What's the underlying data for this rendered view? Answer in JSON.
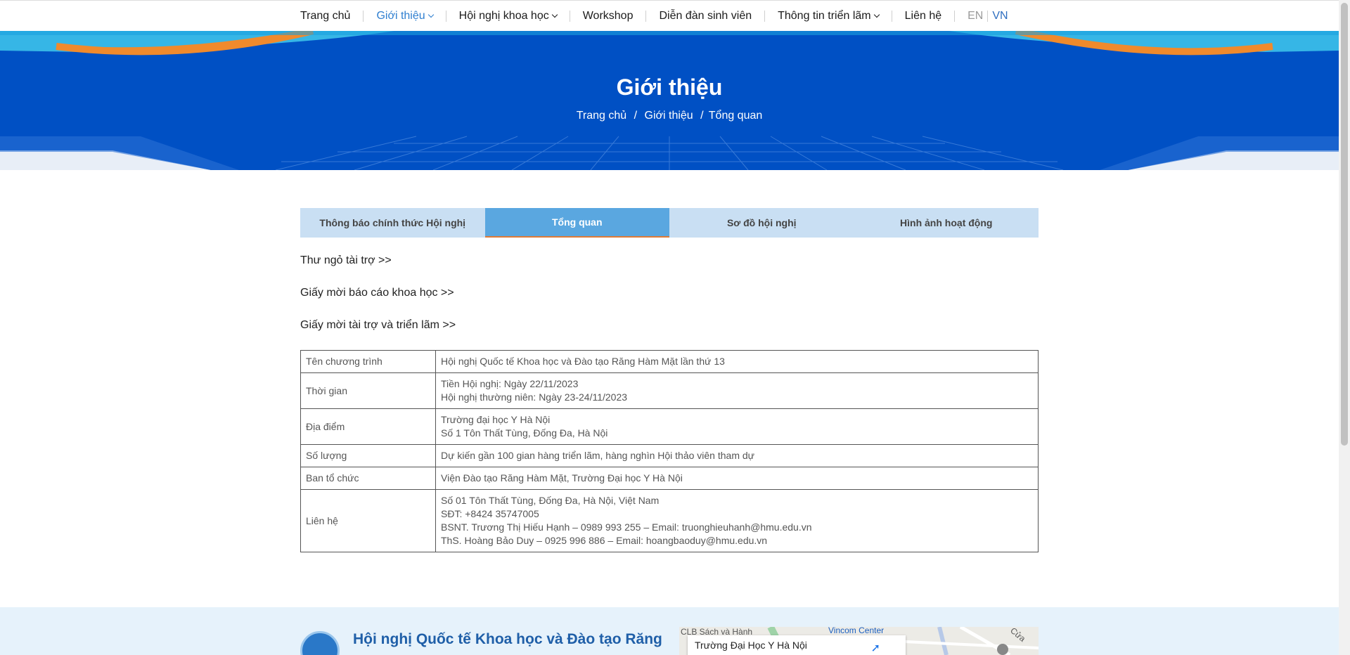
{
  "nav": {
    "items": [
      {
        "label": "Trang chủ",
        "dropdown": false
      },
      {
        "label": "Giới thiệu",
        "dropdown": true,
        "active": true
      },
      {
        "label": "Hội nghị khoa học",
        "dropdown": true
      },
      {
        "label": "Workshop",
        "dropdown": false
      },
      {
        "label": "Diễn đàn sinh viên",
        "dropdown": false
      },
      {
        "label": "Thông tin triển lãm",
        "dropdown": true
      },
      {
        "label": "Liên hệ",
        "dropdown": false
      }
    ],
    "lang_en": "EN",
    "lang_vn": "VN"
  },
  "banner": {
    "title": "Giới thiệu",
    "breadcrumb": [
      "Trang chủ",
      "Giới thiệu",
      "Tổng quan"
    ]
  },
  "tabs": [
    {
      "label": "Thông báo chính thức Hội nghị",
      "active": false
    },
    {
      "label": "Tổng quan",
      "active": true
    },
    {
      "label": "Sơ đồ hội nghị",
      "active": false
    },
    {
      "label": "Hình ảnh hoạt động",
      "active": false
    }
  ],
  "links": [
    "Thư ngỏ tài trợ >>",
    "Giấy mời báo cáo khoa học >>",
    "Giấy mời tài trợ và triển lãm >>"
  ],
  "table": [
    {
      "label": "Tên chương trình",
      "lines": [
        "Hội nghị Quốc tế Khoa học và Đào tạo Răng Hàm Mặt lần thứ 13"
      ]
    },
    {
      "label": "Thời gian",
      "lines": [
        "Tiền Hội nghị: Ngày 22/11/2023",
        "Hội nghị thường niên: Ngày 23-24/11/2023"
      ]
    },
    {
      "label": "Địa điểm",
      "lines": [
        "Trường đại học Y Hà Nội",
        "Số 1 Tôn Thất Tùng, Đống Đa, Hà Nội"
      ]
    },
    {
      "label": "Số lượng",
      "lines": [
        "Dự kiến gần 100 gian hàng triển lãm, hàng nghìn Hội thảo viên tham dự"
      ]
    },
    {
      "label": "Ban tổ chức",
      "lines": [
        "Viện Đào tạo Răng Hàm Mặt, Trường Đại học Y Hà Nội"
      ]
    },
    {
      "label": "Liên hệ",
      "lines": [
        "Số 01 Tôn Thất Tùng, Đống Đa, Hà Nội, Việt Nam",
        "SĐT: +8424 35747005",
        "BSNT. Trương Thị Hiếu Hạnh – 0989 993 255 – Email: truonghieuhanh@hmu.edu.vn",
        "ThS. Hoàng Bảo Duy – 0925 996 886 – Email: hoangbaoduy@hmu.edu.vn"
      ]
    }
  ],
  "footer": {
    "title": "Hội nghị Quốc tế Khoa học và Đào tạo Răng",
    "map_card_title": "Trường Đại Học Y Hà Nội",
    "map_labels": [
      "CLB Sách và Hành",
      "Vincom Center",
      "Cửa"
    ]
  },
  "colors": {
    "accent_blue": "#2f7fd0",
    "banner_blue": "#0050c4",
    "tab_active": "#5aa7e0",
    "tab_bg": "#c9dff3",
    "tab_underline": "#e07a35",
    "footer_bg": "#e6f2fb"
  }
}
